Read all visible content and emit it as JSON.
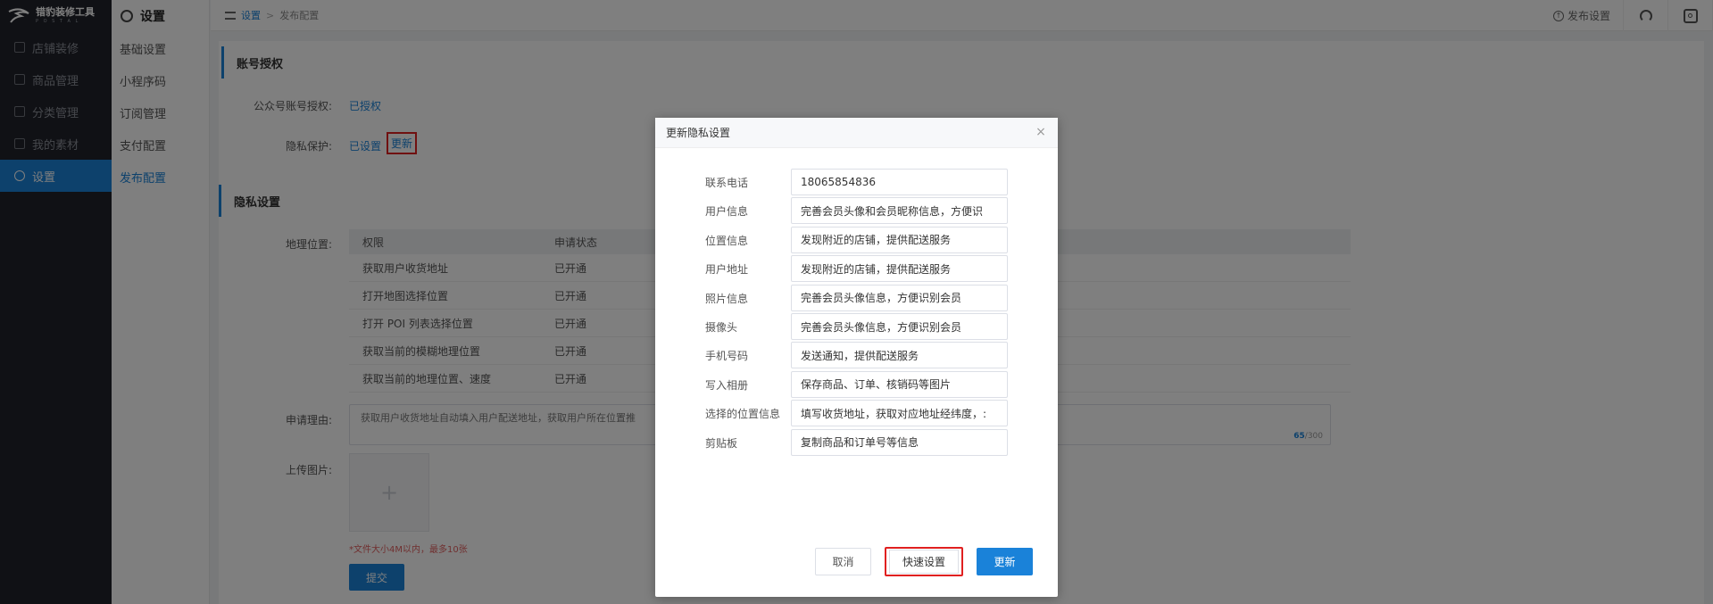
{
  "app": {
    "logo_title": "错豹装修工具",
    "logo_sub": "P O S T A L"
  },
  "nav": {
    "items": [
      {
        "label": "店铺装修",
        "icon": "store-icon"
      },
      {
        "label": "商品管理",
        "icon": "grid-icon"
      },
      {
        "label": "分类管理",
        "icon": "category-icon"
      },
      {
        "label": "我的素材",
        "icon": "image-icon"
      },
      {
        "label": "设置",
        "icon": "gear-icon",
        "active": true
      }
    ]
  },
  "subnav": {
    "title": "设置",
    "items": [
      "基础设置",
      "小程序码",
      "订阅管理",
      "支付配置",
      "发布配置"
    ],
    "active_index": 4
  },
  "breadcrumb": {
    "home": "设置",
    "sep": ">",
    "current": "发布配置"
  },
  "topbar": {
    "publish_label": "发布设置"
  },
  "account_section": {
    "title": "账号授权",
    "wechat_label": "公众号账号授权:",
    "wechat_value": "已授权",
    "privacy_label": "隐私保护:",
    "privacy_set": "已设置",
    "privacy_update": "更新"
  },
  "privacy_section": {
    "title": "隐私设置",
    "location_label": "地理位置:",
    "table": {
      "headers": [
        "权限",
        "申请状态"
      ],
      "rows": [
        [
          "获取用户收货地址",
          "已开通"
        ],
        [
          "打开地图选择位置",
          "已开通"
        ],
        [
          "打开 POI 列表选择位置",
          "已开通"
        ],
        [
          "获取当前的模糊地理位置",
          "已开通"
        ],
        [
          "获取当前的地理位置、速度",
          "已开通"
        ]
      ]
    },
    "reason_label": "申请理由:",
    "reason_text": "获取用户收货地址自动填入用户配送地址，获取用户所在位置推",
    "reason_count": "65",
    "reason_max": "/300",
    "upload_label": "上传图片:",
    "upload_plus": "+",
    "upload_hint": "*文件大小4M以内，最多10张",
    "submit_label": "提交"
  },
  "modal": {
    "title": "更新隐私设置",
    "close": "×",
    "fields": [
      {
        "label": "联系电话",
        "value": "18065854836"
      },
      {
        "label": "用户信息",
        "value": "完善会员头像和会员昵称信息，方便识"
      },
      {
        "label": "位置信息",
        "value": "发现附近的店铺，提供配送服务"
      },
      {
        "label": "用户地址",
        "value": "发现附近的店铺，提供配送服务"
      },
      {
        "label": "照片信息",
        "value": "完善会员头像信息，方便识别会员"
      },
      {
        "label": "摄像头",
        "value": "完善会员头像信息，方便识别会员"
      },
      {
        "label": "手机号码",
        "value": "发送通知，提供配送服务"
      },
      {
        "label": "写入相册",
        "value": "保存商品、订单、核销码等图片"
      },
      {
        "label": "选择的位置信息",
        "value": "填写收货地址，获取对应地址经纬度，:"
      },
      {
        "label": "剪贴板",
        "value": "复制商品和订单号等信息"
      }
    ],
    "cancel_label": "取消",
    "quick_label": "快速设置",
    "update_label": "更新"
  },
  "colors": {
    "accent": "#1a82d9",
    "nav_bg": "#20222a",
    "highlight": "#e02020"
  }
}
